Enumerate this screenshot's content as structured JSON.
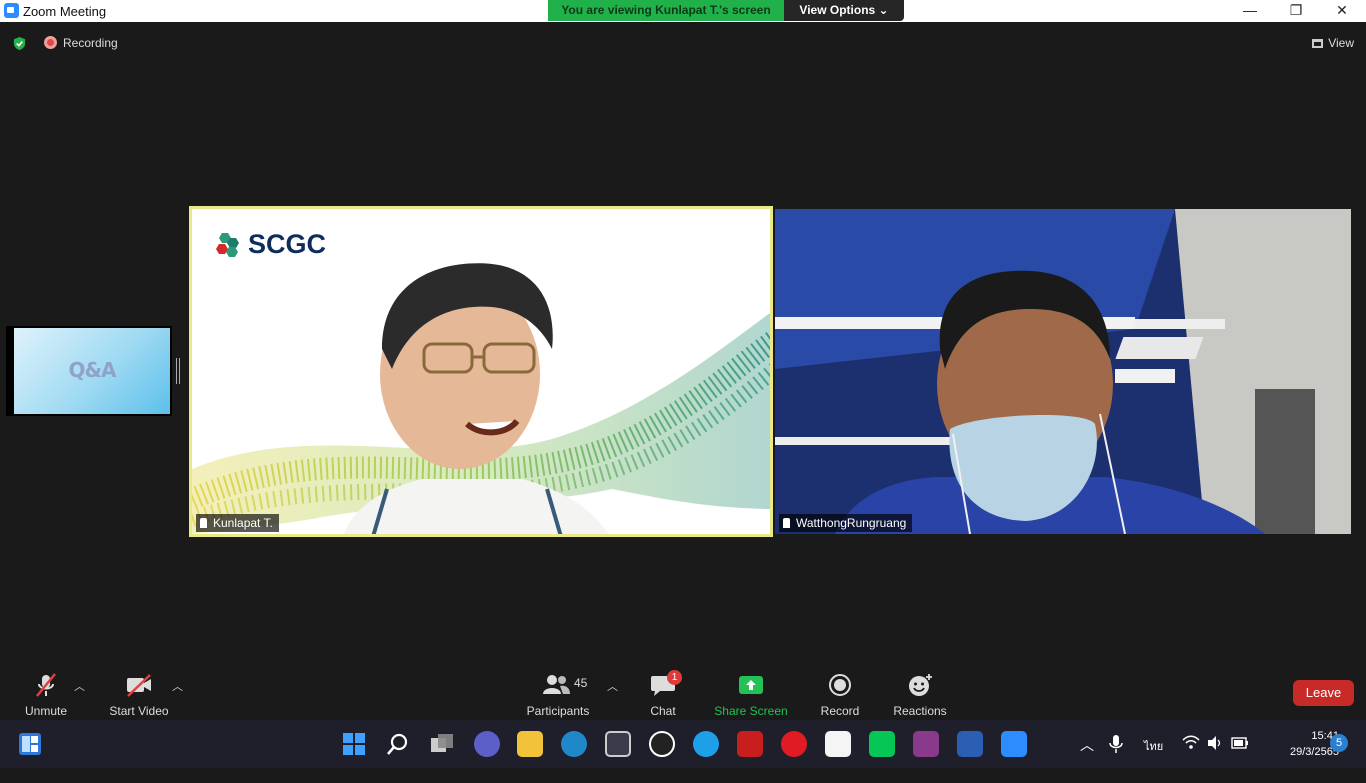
{
  "window": {
    "title": "Zoom Meeting",
    "minimize": "—",
    "restore": "❐",
    "close": "✕"
  },
  "banner": {
    "viewing": "You are viewing Kunlapat T.'s screen",
    "view_options": "View Options ⌄"
  },
  "top_bar": {
    "recording": "Recording",
    "view": "View"
  },
  "share_preview": {
    "slide_text": "Q&A"
  },
  "videos": [
    {
      "name": "Kunlapat T.",
      "logo_text": "SCGC"
    },
    {
      "name": "WatthongRungruang"
    }
  ],
  "toolbar": {
    "unmute": "Unmute",
    "start_video": "Start Video",
    "participants": "Participants",
    "participants_count": "45",
    "chat": "Chat",
    "chat_badge": "1",
    "share_screen": "Share Screen",
    "record": "Record",
    "reactions": "Reactions",
    "leave": "Leave"
  },
  "taskbar": {
    "ime": "ไทย",
    "time": "15:41",
    "date": "29/3/2565",
    "notifications": "5"
  },
  "colors": {
    "active_speaker_border": "#e9e98a",
    "share_green": "#24c156",
    "leave_red": "#c82a28",
    "banner_green": "#20b14b"
  }
}
